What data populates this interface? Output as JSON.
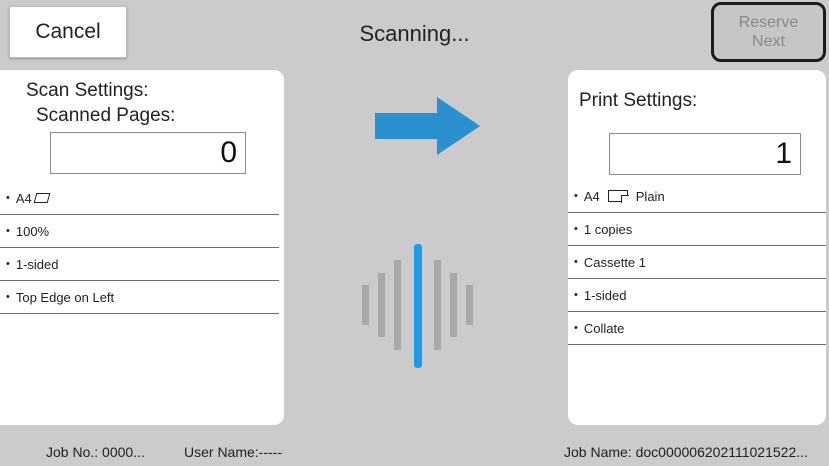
{
  "header": {
    "cancel_label": "Cancel",
    "title": "Scanning...",
    "reserve_line1": "Reserve",
    "reserve_line2": "Next"
  },
  "scan": {
    "heading": "Scan Settings:",
    "subheading": "Scanned Pages:",
    "count": "0",
    "items": [
      "A4",
      "100%",
      "1-sided",
      "Top Edge on Left"
    ]
  },
  "print": {
    "heading": "Print Settings:",
    "count": "1",
    "items": [
      "A4",
      "1 copies",
      "Cassette 1",
      "1-sided",
      "Collate"
    ],
    "paper_type": "Plain"
  },
  "footer": {
    "job_no": "Job No.: 0000...",
    "user_name": "User Name:-----",
    "job_name": "Job Name: doc000006202111021522..."
  },
  "colors": {
    "accent": "#2a90cf",
    "wave_active": "#1e9be8",
    "wave_bars": "#a8a8a8",
    "background": "#cbcbcb"
  },
  "icons": {
    "arrow": "right-arrow-icon",
    "scan_wave": "scan-wave-icon",
    "original_orientation": "paper-landscape-icon",
    "print_paper": "paper-icon"
  }
}
